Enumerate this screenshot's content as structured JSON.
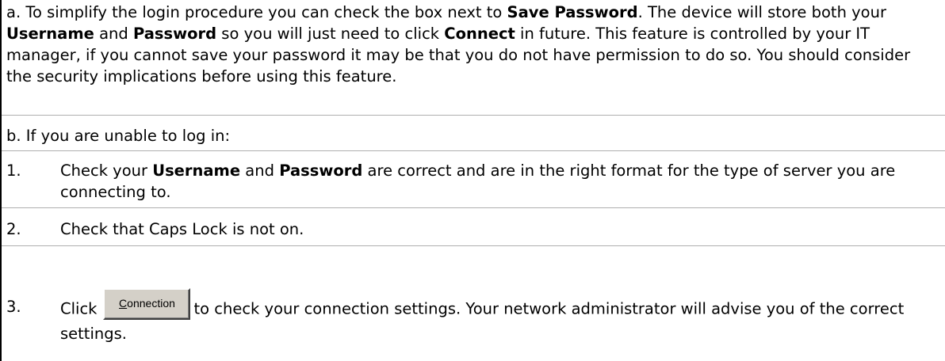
{
  "para_a": {
    "t1": "a. To simplify the login procedure you can check the box next to ",
    "b1": "Save Password",
    "t2": ". The device will store both your ",
    "b2": "Username",
    "t3": " and ",
    "b3": "Password",
    "t4": " so you will just need to click ",
    "b4": "Connect",
    "t5": " in future. This feature is controlled by your IT manager, if you cannot save your password it may be that you do not have permission to do so.  You should consider the security implications before using this feature."
  },
  "para_b": {
    "text": "b. If you are unable to log in:"
  },
  "steps": [
    {
      "num": "1.",
      "t1": "Check your ",
      "b1": "Username",
      "t2": " and ",
      "b2": "Password",
      "t3": " are correct and are in the right format for the type of server you are connecting to."
    },
    {
      "num": "2.",
      "t1": "Check that Caps Lock is not on."
    },
    {
      "num": "3.",
      "t1": "Click",
      "t2": "to check your connection settings. Your network administrator will advise you of the correct settings."
    }
  ],
  "connection_button": {
    "mnemonic": "C",
    "rest": "onnection"
  }
}
